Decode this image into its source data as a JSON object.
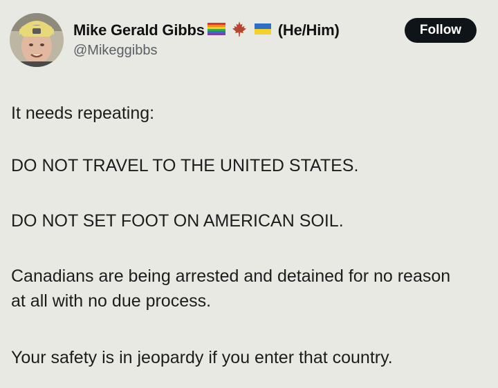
{
  "author": {
    "display_name": "Mike Gerald Gibbs",
    "flags": [
      "rainbow-flag-icon",
      "maple-leaf-icon",
      "ukraine-flag-icon"
    ],
    "pronouns": "(He/Him)",
    "handle": "@Mikeggibbs"
  },
  "actions": {
    "follow_label": "Follow"
  },
  "post": {
    "paragraphs": [
      "It needs repeating:",
      "DO NOT TRAVEL TO THE UNITED STATES.",
      "DO NOT SET FOOT ON AMERICAN SOIL.",
      "Canadians are being arrested and detained for no reason at all with no due process.",
      "Your safety is in jeopardy if you enter that country."
    ]
  },
  "colors": {
    "background": "#e9e9e4",
    "text": "#1c1c1c",
    "handle": "#5b5f63",
    "follow_button_bg": "#0f1419",
    "follow_button_text": "#ffffff"
  }
}
